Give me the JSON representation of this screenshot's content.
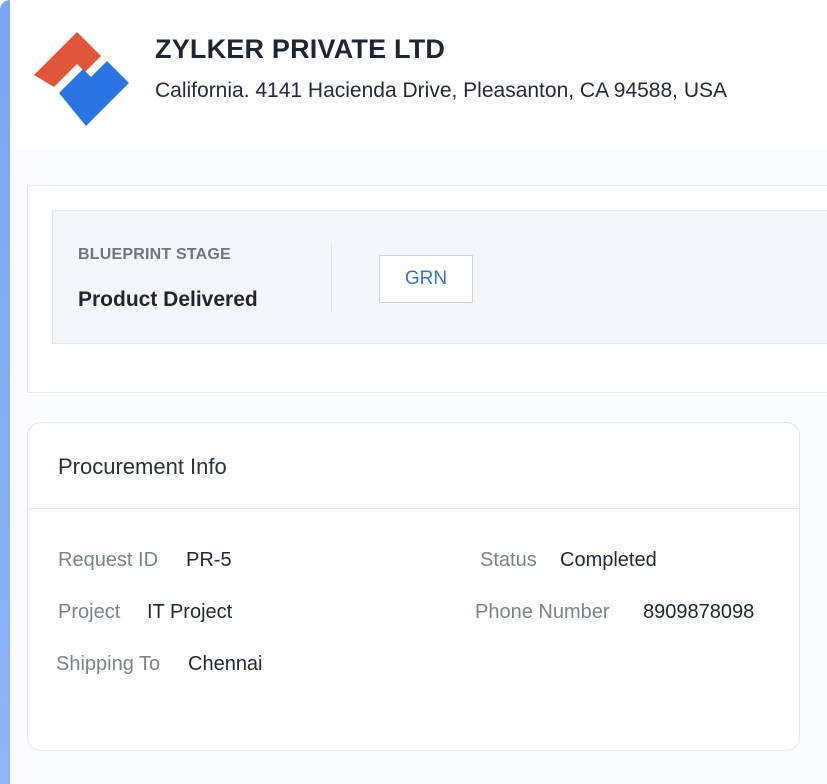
{
  "company": {
    "name": "ZYLKER PRIVATE LTD",
    "address": "California. 4141 Hacienda Drive, Pleasanton, CA 94588, USA",
    "logo_colors": {
      "orange": "#e0563a",
      "blue": "#2b74e4"
    }
  },
  "blueprint": {
    "label": "BLUEPRINT STAGE",
    "stage": "Product Delivered",
    "action_button": "GRN"
  },
  "procurement": {
    "title": "Procurement Info",
    "fields": {
      "request_id": {
        "label": "Request ID",
        "value": "PR-5"
      },
      "status": {
        "label": "Status",
        "value": "Completed"
      },
      "project": {
        "label": "Project",
        "value": "IT Project"
      },
      "phone": {
        "label": "Phone Number",
        "value": "8909878098"
      },
      "shipping": {
        "label": "Shipping To",
        "value": "Chennai"
      }
    }
  },
  "colors": {
    "accent_blue": "#3a6fd8",
    "side_accent": "#7aa6f3"
  }
}
